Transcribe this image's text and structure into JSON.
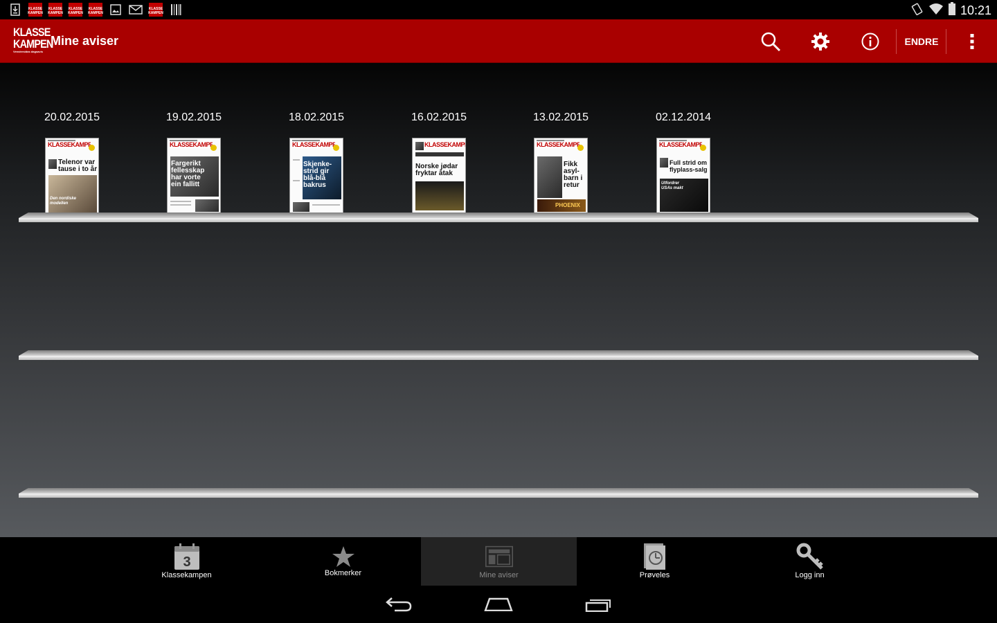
{
  "status_bar": {
    "time": "10:21",
    "notification_icons": [
      "download-icon",
      "klassekampen-icon",
      "klassekampen-icon",
      "klassekampen-icon",
      "klassekampen-icon",
      "image-icon",
      "gmail-icon",
      "klassekampen-icon",
      "barcode-icon"
    ],
    "kk_icon_text": "KLASSE KAMPEN"
  },
  "action_bar": {
    "logo_line1": "KLASSE",
    "logo_line2": "KAMPEN",
    "logo_tagline": "Venstresidas dagsavis",
    "title": "Mine aviser",
    "endre_label": "ENDRE",
    "accent_color": "#a90000"
  },
  "issues": [
    {
      "date": "20.02.2015",
      "masthead": "KLASSEKAMPEN",
      "headline": "Telenor var tause i to år",
      "subline": "Den nordiske modellen"
    },
    {
      "date": "19.02.2015",
      "masthead": "KLASSEKAMPEN",
      "headline": "Fargerikt fellesskap har vorte ein fallitt",
      "subline": ""
    },
    {
      "date": "18.02.2015",
      "masthead": "KLASSEKAMPEN",
      "headline": "Skjenke-strid gir blå-blå bakrus",
      "subline": ""
    },
    {
      "date": "16.02.2015",
      "masthead": "KLASSEKAMPEN",
      "headline": "Norske jødar fryktar åtak",
      "subline": ""
    },
    {
      "date": "13.02.2015",
      "masthead": "KLASSEKAMPEN",
      "headline": "Fikk asyl-barn i retur",
      "subline": "PHOENIX"
    },
    {
      "date": "02.12.2014",
      "masthead": "KLASSEKAMPEN",
      "headline": "Full strid om flyplass-salg",
      "subline": "Utfordrer USAs makt"
    }
  ],
  "tabs": [
    {
      "label": "Klassekampen",
      "icon": "calendar-icon",
      "calendar_day": "3"
    },
    {
      "label": "Bokmerker",
      "icon": "star-icon"
    },
    {
      "label": "Mine aviser",
      "icon": "newspaper-icon",
      "active": true
    },
    {
      "label": "Prøveles",
      "icon": "sample-read-icon"
    },
    {
      "label": "Logg inn",
      "icon": "key-icon"
    }
  ]
}
